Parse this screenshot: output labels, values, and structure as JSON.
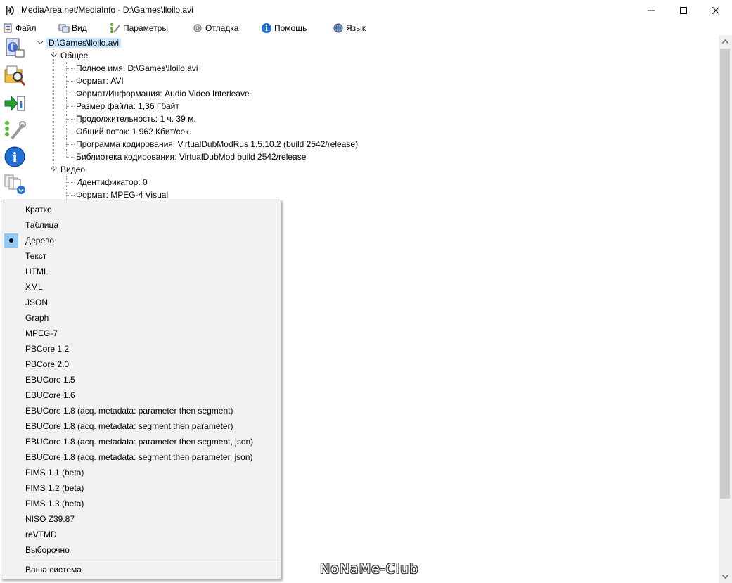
{
  "window": {
    "title": "MediaArea.net/MediaInfo - D:\\Games\\lloilo.avi",
    "controls": [
      "minimize-icon",
      "maximize-icon",
      "close-icon"
    ]
  },
  "menu": [
    {
      "label": "Файл",
      "icon": "file-icon"
    },
    {
      "label": "Вид",
      "icon": "view-icon"
    },
    {
      "label": "Параметры",
      "icon": "options-icon"
    },
    {
      "label": "Отладка",
      "icon": "debug-icon"
    },
    {
      "label": "Помощь",
      "icon": "help-icon"
    },
    {
      "label": "Язык",
      "icon": "language-icon"
    }
  ],
  "toolbar": [
    {
      "icon": "open-file-icon"
    },
    {
      "icon": "open-folder-icon"
    },
    {
      "icon": "export-icon"
    },
    {
      "icon": "preferences-icon"
    },
    {
      "icon": "about-info-icon"
    },
    {
      "icon": "view-mode-icon"
    }
  ],
  "tree": {
    "root": "D:\\Games\\lloilo.avi",
    "sections": [
      {
        "label": "Общее",
        "items": [
          "Полное имя: D:\\Games\\lloilo.avi",
          "Формат: AVI",
          "Формат/Информация: Audio Video Interleave",
          "Размер файла: 1,36 Гбайт",
          "Продолжительность: 1 ч. 39 м.",
          "Общий поток: 1 962 Кбит/сек",
          "Программа кодирования: VirtualDubModRus 1.5.10.2 (build 2542/release)",
          "Библиотека кодирования: VirtualDubMod build 2542/release"
        ]
      },
      {
        "label": "Видео",
        "items": [
          "Идентификатор: 0",
          "Формат: MPEG-4 Visual"
        ]
      }
    ]
  },
  "view_menu": {
    "selected": "Дерево",
    "items": [
      "Кратко",
      "Таблица",
      "Дерево",
      "Текст",
      "HTML",
      "XML",
      "JSON",
      "Graph",
      "MPEG-7",
      "PBCore 1.2",
      "PBCore 2.0",
      "EBUCore 1.5",
      "EBUCore 1.6",
      "EBUCore 1.8 (acq. metadata: parameter then segment)",
      "EBUCore 1.8 (acq. metadata: segment then parameter)",
      "EBUCore 1.8 (acq. metadata: parameter then segment, json)",
      "EBUCore 1.8 (acq. metadata: segment then parameter, json)",
      "FIMS 1.1 (beta)",
      "FIMS 1.2 (beta)",
      "FIMS 1.3 (beta)",
      "NISO Z39.87",
      "reVTMD",
      "Выборочно"
    ],
    "footer_item": "Ваша система"
  },
  "watermark": "NoNaMe-Club",
  "colors": {
    "selection": "#cce8ff",
    "checked_highlight": "#90c8f6",
    "menu_background": "#f2f2f2"
  }
}
